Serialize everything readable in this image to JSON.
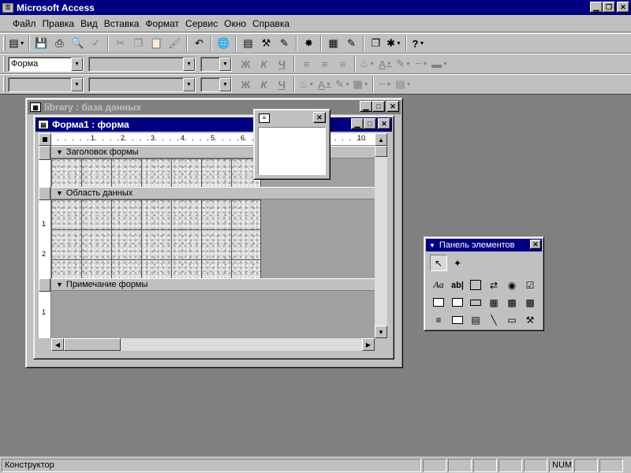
{
  "app": {
    "title": "Microsoft Access"
  },
  "menu": {
    "items": [
      "Файл",
      "Правка",
      "Вид",
      "Вставка",
      "Формат",
      "Сервис",
      "Окно",
      "Справка"
    ]
  },
  "format_toolbar": {
    "object_combo": "Форма",
    "bold": "Ж",
    "italic": "К",
    "underline": "Ч"
  },
  "db_window": {
    "title": "library : база данных"
  },
  "form_window": {
    "title": "Форма1 : форма",
    "ruler_labels": [
      "1",
      "2",
      "3",
      "4",
      "5",
      "6",
      "10"
    ],
    "vruler_labels": [
      "1",
      "2",
      "1"
    ],
    "sections": {
      "header": "Заголовок формы",
      "detail": "Область данных",
      "footer": "Примечание формы"
    }
  },
  "toolbox": {
    "title": "Панель элементов",
    "label_tool": "Aa",
    "textbox_tool": "ab|"
  },
  "status": {
    "mode": "Конструктор",
    "num": "NUM"
  },
  "colors": {
    "title_active": "#000080",
    "title_inactive": "#808080",
    "workspace": "#808080",
    "face": "#c0c0c0"
  }
}
